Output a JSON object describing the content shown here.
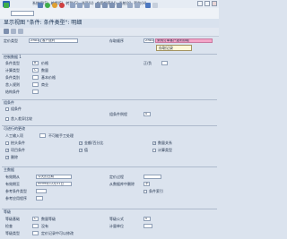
{
  "menubar": {
    "items": [
      "系统规(S)",
      "编辑(E)",
      "转到(G)",
      "选项(U)",
      "实用程序(U)",
      "系统(Y)",
      "帮助(H)"
    ]
  },
  "window": {
    "title": "显示视图 \"条件: 条件类型\": 明细"
  },
  "header": {
    "cond_type_label": "定价类型",
    "cond_type_code": "ZRA1",
    "cond_type_text": "客户返利",
    "access_seq_label": "存取顺序",
    "access_seq_code": "ZRA1",
    "access_seq_text": "采购订单客户返利存取",
    "popup_text": "存取记录"
  },
  "control": {
    "title": "控制数据 1",
    "cond_class_label": "条件类型",
    "cond_class_value": "B",
    "cond_class_text": "价格",
    "calc_type_label": "计算类型",
    "calc_type_value": "C",
    "calc_type_text": "数量",
    "cond_cat_label": "条件类别",
    "cond_cat_value": "",
    "cond_cat_text": "基本价格",
    "rounding_label": "舍入规则",
    "rounding_value": "",
    "rounding_text": "商业",
    "structure_label": "结构条件",
    "structure_value": "",
    "plus_minus_label": "正/负",
    "plus_minus_value": ""
  },
  "group_cond": {
    "title": "组条件",
    "group_cond_label": "组条件",
    "group_cond_routine_label": "组条件例程",
    "group_cond_routine_value": "0",
    "rounding_diff_label": "舍入差异比较"
  },
  "changes": {
    "title": "可进行的更改",
    "manual_label": "人工输入项",
    "manual_value": "",
    "manual_text": "不可能手工处理",
    "header_cond_label": "抬头条件",
    "item_cond_label": "项目条件",
    "delete_label": "删除",
    "amount_label": "金额/百分比",
    "qty_rel_label": "数量关系",
    "value_label": "值",
    "calc_type_label": "计算类型"
  },
  "master": {
    "title": "主数据",
    "valid_from_label": "有效期从",
    "valid_from_value": "今天的日期",
    "valid_to_label": "有效期至",
    "valid_to_value": "9999年12月31日",
    "ref_cond_type_label": "参考条件类型",
    "ref_app_label": "参考应用程序",
    "pricing_proc_label": "定价过程",
    "pricing_proc_value": "",
    "delete_db_label": "从数据库中删除",
    "delete_db_value": "不",
    "cond_index_label": "条件索引"
  },
  "scales": {
    "title": "等级",
    "scale_basis_label": "等级基础",
    "scale_basis_value": "C",
    "scale_basis_text": "数量等级",
    "check_label": "检查",
    "check_value": "",
    "check_text": "没有",
    "scale_type_label": "等级类型",
    "scale_type_value": "",
    "scale_formula_label": "等级公式",
    "scale_formula_value": "0",
    "unit_label": "计量单位",
    "scale_type_text": "定价记录中可以修改"
  },
  "colors": {
    "accent": "#2a62b8",
    "highlight": "#f4a6c8",
    "background": "#dbe3ee"
  }
}
